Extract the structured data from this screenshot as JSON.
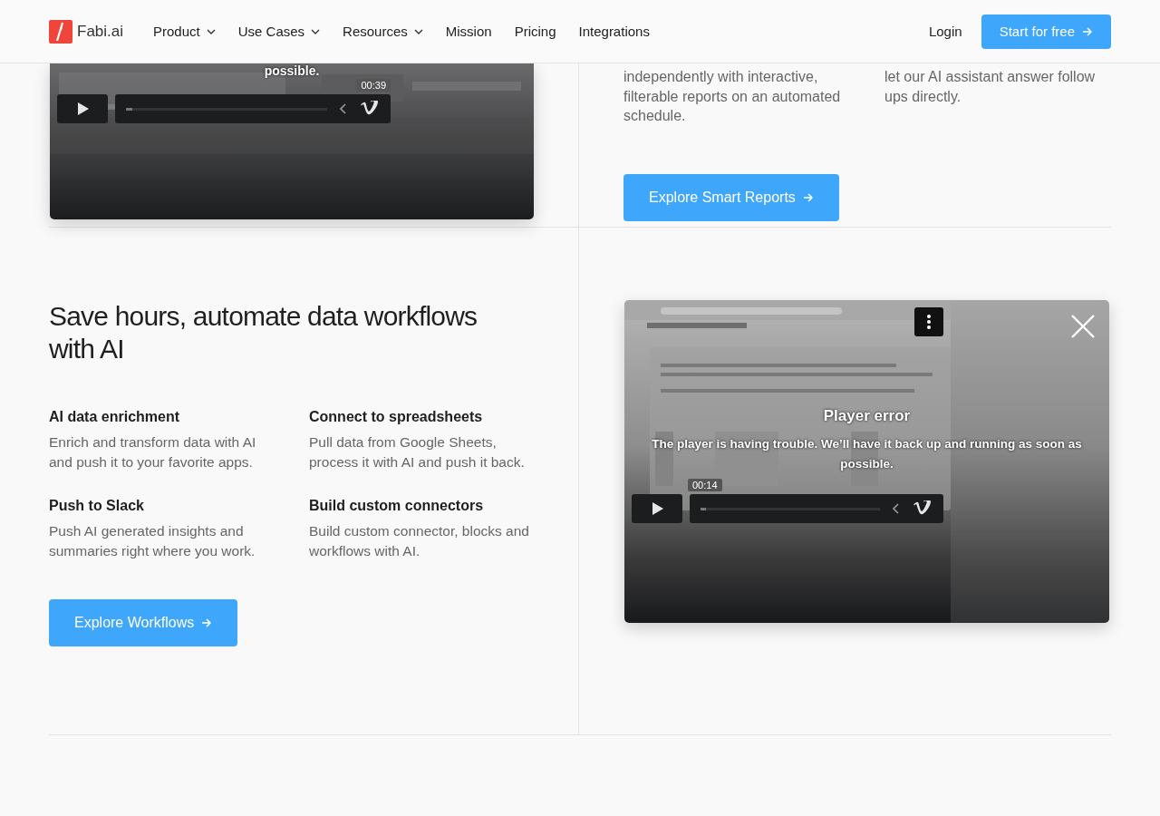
{
  "header": {
    "brand": "Fabi.ai",
    "nav": [
      {
        "label": "Product",
        "kind": "dropdown"
      },
      {
        "label": "Use Cases",
        "kind": "dropdown"
      },
      {
        "label": "Resources",
        "kind": "dropdown"
      },
      {
        "label": "Mission",
        "kind": "link"
      },
      {
        "label": "Pricing",
        "kind": "link"
      },
      {
        "label": "Integrations",
        "kind": "link"
      }
    ],
    "login": "Login",
    "cta": "Start for free"
  },
  "reports_section": {
    "video": {
      "kind": "picture",
      "message": "possible.",
      "time": "00:39",
      "progress": {
        "level": 0.03
      }
    },
    "features": [
      {
        "description": "independently with interactive, filterable reports on an automated schedule."
      },
      {
        "description": "let our AI assistant answer follow ups directly."
      }
    ],
    "button": "Explore Smart Reports"
  },
  "workflows_section": {
    "title": "Save hours, automate data workflows with AI",
    "features": [
      {
        "title": "AI data enrichment",
        "description": "Enrich and transform data with AI and push it to your favorite apps."
      },
      {
        "title": "Connect to spreadsheets",
        "description": "Pull data from Google Sheets, process it with AI and push it back."
      },
      {
        "title": "Push to Slack",
        "description": "Push AI generated insights and summaries right where you work."
      },
      {
        "title": "Build custom connectors",
        "description": "Build custom connector, blocks and workflows with AI."
      }
    ],
    "button": "Explore Workflows",
    "video": {
      "kind": "picture",
      "error_title": "Player error",
      "message": "The player is having trouble. We’ll have it back up and running as soon as possible.",
      "time": "00:14",
      "progress": {
        "level": 0.03
      }
    }
  }
}
